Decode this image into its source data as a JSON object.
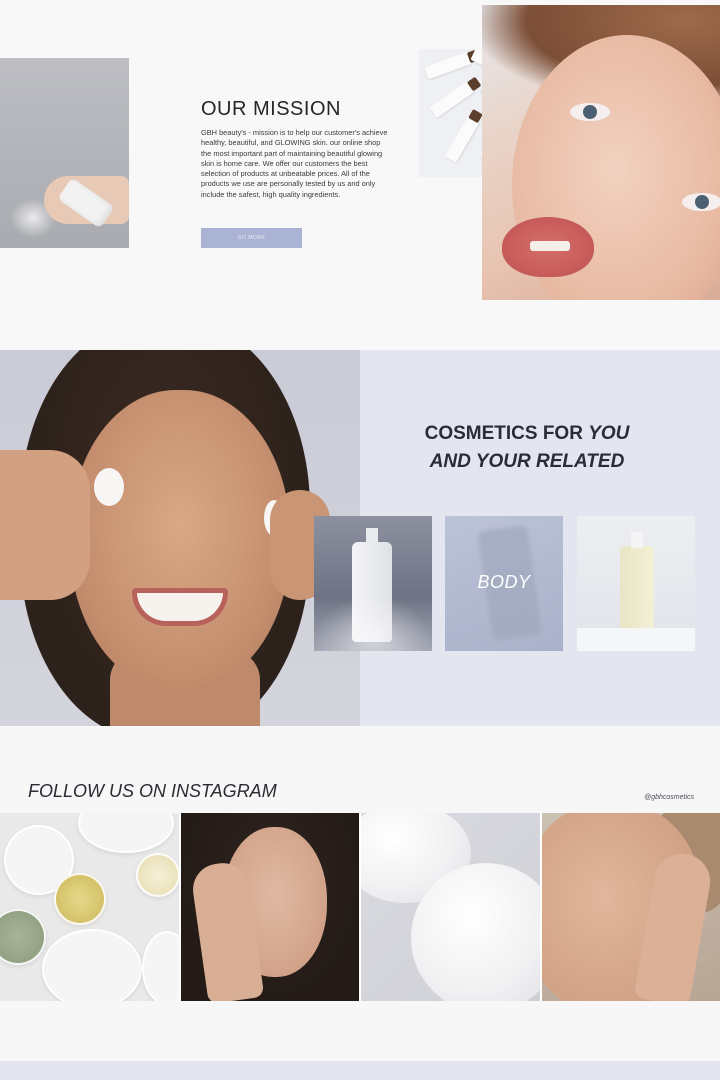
{
  "mission": {
    "title": "OUR MISSION",
    "body": "GBH beauty's - mission is to help our customer's achieve healthy, beautiful, and GLOWING skin. our online shop the most important part of maintaining beautiful glowing skin is home care. We offer our customers the best selection of products at unbeatable prices. All of the products we use are personally tested by us and only include the safest, high quality ingredients.",
    "button_label": "GO MORE"
  },
  "cosmetics": {
    "heading_line1_plain": "COSMETICS FOR ",
    "heading_line1_italic": "YOU",
    "heading_line2_italic": "AND YOUR RELATED",
    "cards": [
      {
        "label": ""
      },
      {
        "label": "BODY"
      },
      {
        "label": ""
      }
    ]
  },
  "instagram": {
    "title": "FOLLOW US ON INSTAGRAM",
    "handle": "@gbhcosmetics"
  },
  "colors": {
    "accent": "#aab3d3",
    "section_bg": "#e3e5ef",
    "page_bg": "#f7f7f8"
  }
}
